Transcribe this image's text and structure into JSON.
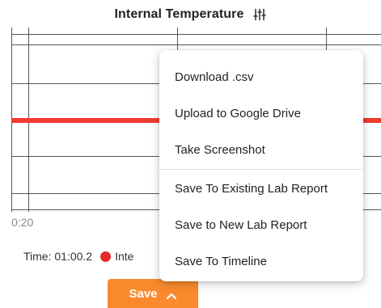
{
  "chart": {
    "title": "Internal Temperature",
    "x_tick_label": "0:20",
    "series_color": "#f03a2e",
    "grid_color": "#555555"
  },
  "status": {
    "time_label": "Time: 01:00.2",
    "series_label": "Inte",
    "series_color": "#e52a2a"
  },
  "save_button": {
    "label": "Save",
    "color": "#fb8a2e"
  },
  "menu": {
    "items": [
      "Download .csv",
      "Upload to Google Drive",
      "Take Screenshot",
      "Save To Existing Lab Report",
      "Save to New Lab Report",
      "Save To Timeline"
    ]
  },
  "icons": {
    "settings": "sliders-icon",
    "save_chevron": "chevron-up-icon"
  }
}
